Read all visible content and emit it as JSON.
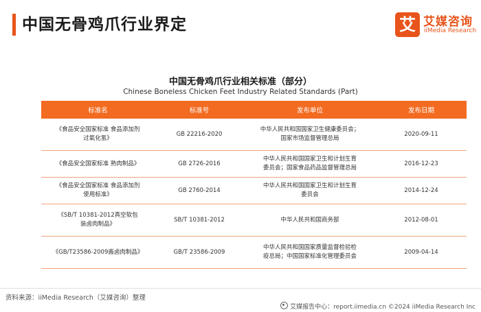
{
  "header": {
    "title": "中国无骨鸡爪行业界定",
    "logo_mark": "艾",
    "logo_cn": "艾媒咨询",
    "logo_en": "iiMedia Research"
  },
  "table": {
    "title_cn": "中国无骨鸡爪行业相关标准（部分）",
    "title_en": "Chinese Boneless Chicken Feet Industry Related Standards (Part)",
    "headers": [
      "标准名",
      "标准号",
      "发布单位",
      "发布日期"
    ],
    "rows": [
      {
        "name": [
          "《食品安全国家标准 食品添加剂",
          "过氧化氢》"
        ],
        "number": "GB 22216-2020",
        "publisher": [
          "中华人民共和国国家卫生健康委员会；",
          "国家市场监督管理总局"
        ],
        "date": "2020-09-11"
      },
      {
        "name": [
          "《食品安全国家标准 熟肉制品》"
        ],
        "number": "GB 2726-2016",
        "publisher": [
          "中华人民共和国国家卫生和计划生育",
          "委员会；国家食品药品监督管理总局"
        ],
        "date": "2016-12-23"
      },
      {
        "name": [
          "《食品安全国家标准 食品添加剂",
          "使用标准》"
        ],
        "number": "GB 2760-2014",
        "publisher": [
          "中华人民共和国国家卫生和计划生育",
          "委员会"
        ],
        "date": "2014-12-24"
      },
      {
        "name": [
          "《SB/T 10381-2012真空软包",
          "装卤肉制品》"
        ],
        "number": "SB/T 10381-2012",
        "publisher": [
          "中华人民共和国商务部"
        ],
        "date": "2012-08-01"
      },
      {
        "name": [
          "《GB/T23586-2009酱卤肉制品》"
        ],
        "number": "GB/T 23586-2009",
        "publisher": [
          "中华人民共和国国家质量监督检验检",
          "疫总局；中国国家标准化管理委员会"
        ],
        "date": "2009-04-14"
      }
    ]
  },
  "footer": {
    "source": "资料来源：iiMedia Research（艾媒咨询）整理",
    "right": "艾媒报告中心：report.iimedia.cn    ©2024  iiMedia Research  Inc"
  },
  "colors": {
    "accent": "#e8541b",
    "table_header": "#f26b21"
  }
}
